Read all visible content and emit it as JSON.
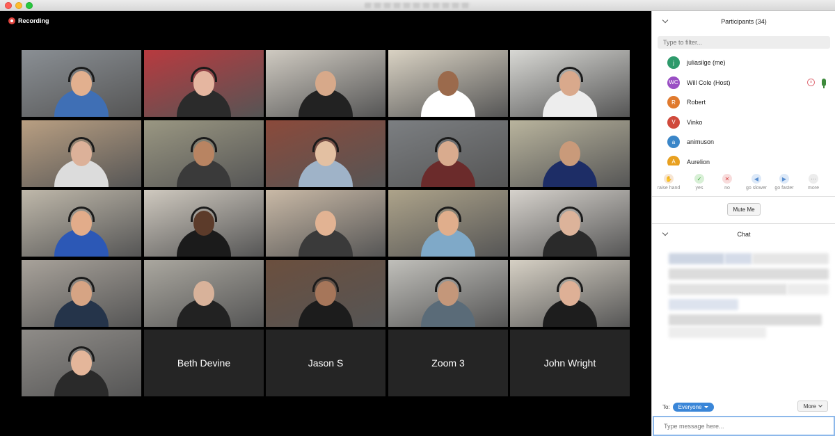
{
  "recording": {
    "label": "Recording"
  },
  "grid": {
    "tiles": [
      {
        "bg": "#8a8f94",
        "shirt": "#3f6fb5",
        "skin": "#e2b08f",
        "headset": true,
        "active": true
      },
      {
        "bg": "#b83a3f",
        "shirt": "#2b2b2b",
        "skin": "#e5b6a0",
        "headset": true
      },
      {
        "bg": "#cfcac1",
        "shirt": "#222222",
        "skin": "#d7a98a",
        "headset": false
      },
      {
        "bg": "#d9d2c3",
        "shirt": "#ffffff",
        "skin": "#9b6a4c",
        "headset": false
      },
      {
        "bg": "#d8d8d4",
        "shirt": "#ededed",
        "skin": "#d9a98c",
        "headset": true
      },
      {
        "bg": "#b99f82",
        "shirt": "#dcdcdc",
        "skin": "#dcb199",
        "headset": true
      },
      {
        "bg": "#9a9782",
        "shirt": "#3a3a3a",
        "skin": "#b88462",
        "headset": true
      },
      {
        "bg": "#8b4a3b",
        "shirt": "#9fb3c8",
        "skin": "#e3c0a2",
        "headset": true
      },
      {
        "bg": "#7c7f82",
        "shirt": "#6b2b2b",
        "skin": "#d9ab8e",
        "headset": true
      },
      {
        "bg": "#b9b49d",
        "shirt": "#1d2d66",
        "skin": "#c99a7a",
        "headset": false
      },
      {
        "bg": "#bfb8aa",
        "shirt": "#2c58b6",
        "skin": "#e2ac8a",
        "headset": true
      },
      {
        "bg": "#cfc9bf",
        "shirt": "#1b1b1b",
        "skin": "#5c3b2a",
        "headset": true
      },
      {
        "bg": "#c9b9a6",
        "shirt": "#3a3a3a",
        "skin": "#e2b393",
        "headset": false
      },
      {
        "bg": "#ada38a",
        "shirt": "#7fa9c8",
        "skin": "#e0ae8c",
        "headset": true
      },
      {
        "bg": "#d6d2cc",
        "shirt": "#2a2a2a",
        "skin": "#dcb39a",
        "headset": true
      },
      {
        "bg": "#a8a29a",
        "shirt": "#25344a",
        "skin": "#d6a484",
        "headset": true
      },
      {
        "bg": "#aaa79f",
        "shirt": "#222222",
        "skin": "#d8b29a",
        "headset": false
      },
      {
        "bg": "#6b4f3e",
        "shirt": "#1c1c1c",
        "skin": "#a6765a",
        "headset": true
      },
      {
        "bg": "#c0bfba",
        "shirt": "#5a6b78",
        "skin": "#c4977a",
        "headset": true
      },
      {
        "bg": "#d6d0c4",
        "shirt": "#1d1d1d",
        "skin": "#deb096",
        "headset": true
      },
      {
        "bg": "#8f8c88",
        "shirt": "#2a2a2a",
        "skin": "#e4b69a",
        "headset": true
      }
    ],
    "name_tiles": [
      "Beth Devine",
      "Jason S",
      "Zoom 3",
      "John Wright"
    ]
  },
  "participants": {
    "header": "Participants (34)",
    "filter_placeholder": "Type to filter...",
    "list": [
      {
        "initial": "j",
        "name": "juliasilge (me)",
        "color": "#2e9a6b"
      },
      {
        "initial": "WC",
        "name": "Will Cole (Host)",
        "color": "#9a4fc4"
      },
      {
        "initial": "R",
        "name": "Robert",
        "color": "#e07a2e"
      },
      {
        "initial": "V",
        "name": "Vinko",
        "color": "#d04a3c"
      },
      {
        "initial": "a",
        "name": "animuson",
        "color": "#3a86c8"
      },
      {
        "initial": "A",
        "name": "Aurelion",
        "color": "#e8a020"
      }
    ],
    "reactions": [
      {
        "label": "raise hand",
        "icon": "✋",
        "color": "#f7e6d4",
        "fg": "#d89a62"
      },
      {
        "label": "yes",
        "icon": "✓",
        "color": "#d8f0d6",
        "fg": "#3aa23a"
      },
      {
        "label": "no",
        "icon": "✕",
        "color": "#f8dcdc",
        "fg": "#d84444"
      },
      {
        "label": "go slower",
        "icon": "◀",
        "color": "#dde9f8",
        "fg": "#5a8fd0"
      },
      {
        "label": "go faster",
        "icon": "▶",
        "color": "#dde9f8",
        "fg": "#5a8fd0"
      },
      {
        "label": "more",
        "icon": "···",
        "color": "#ececec",
        "fg": "#777777"
      }
    ],
    "mute_label": "Mute Me"
  },
  "chat": {
    "header": "Chat",
    "to_label": "To:",
    "recipient": "Everyone",
    "more_label": "More",
    "input_placeholder": "Type message here..."
  }
}
